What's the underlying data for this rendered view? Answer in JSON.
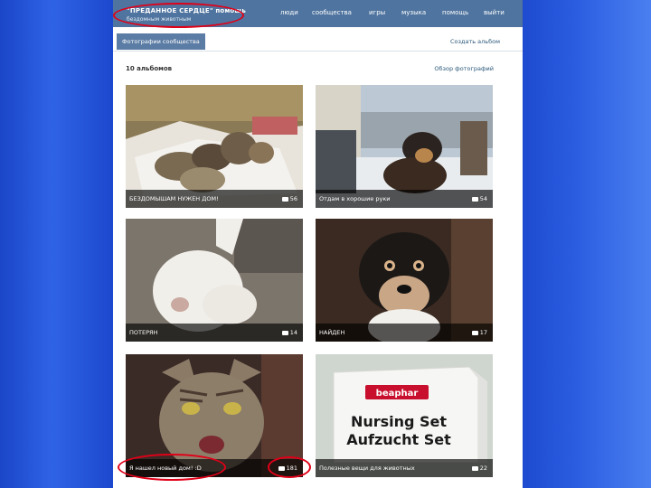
{
  "header": {
    "group_name": "\"ПРЕДАННОЕ СЕРДЦЕ\" помощь",
    "group_subtitle": "бездомным животным",
    "nav": [
      "люди",
      "сообщества",
      "игры",
      "музыка",
      "помощь",
      "выйти"
    ]
  },
  "tabs": {
    "active": "Фотографии сообщества",
    "create_album": "Создать альбом"
  },
  "albums_header": {
    "count": "10 альбомов",
    "overview": "Обзор фотографий"
  },
  "albums": [
    {
      "title": "БЕЗДОМЫШАМ НУЖЕН ДОМ!",
      "count": "56",
      "photo": "puppies-photo"
    },
    {
      "title": "Отдам в хорошие руки",
      "count": "54",
      "photo": "dog-in-yard-photo"
    },
    {
      "title": "ПОТЕРЯН",
      "count": "14",
      "photo": "white-dog-photo"
    },
    {
      "title": "НАЙДЕН",
      "count": "17",
      "photo": "black-dog-photo"
    },
    {
      "title": "Я нашел новый дом! :D",
      "count": "181",
      "photo": "cat-photo"
    },
    {
      "title": "Полезные вещи для животных",
      "count": "22",
      "photo": "product-box-photo"
    }
  ],
  "product": {
    "brand": "beaphar",
    "line1": "Nursing Set",
    "line2": "Aufzucht Set"
  },
  "colors": {
    "background_blue": "#1b46c8",
    "topbar": "#4f749f",
    "highlight_ring": "#e00018",
    "link": "#2b587a"
  }
}
